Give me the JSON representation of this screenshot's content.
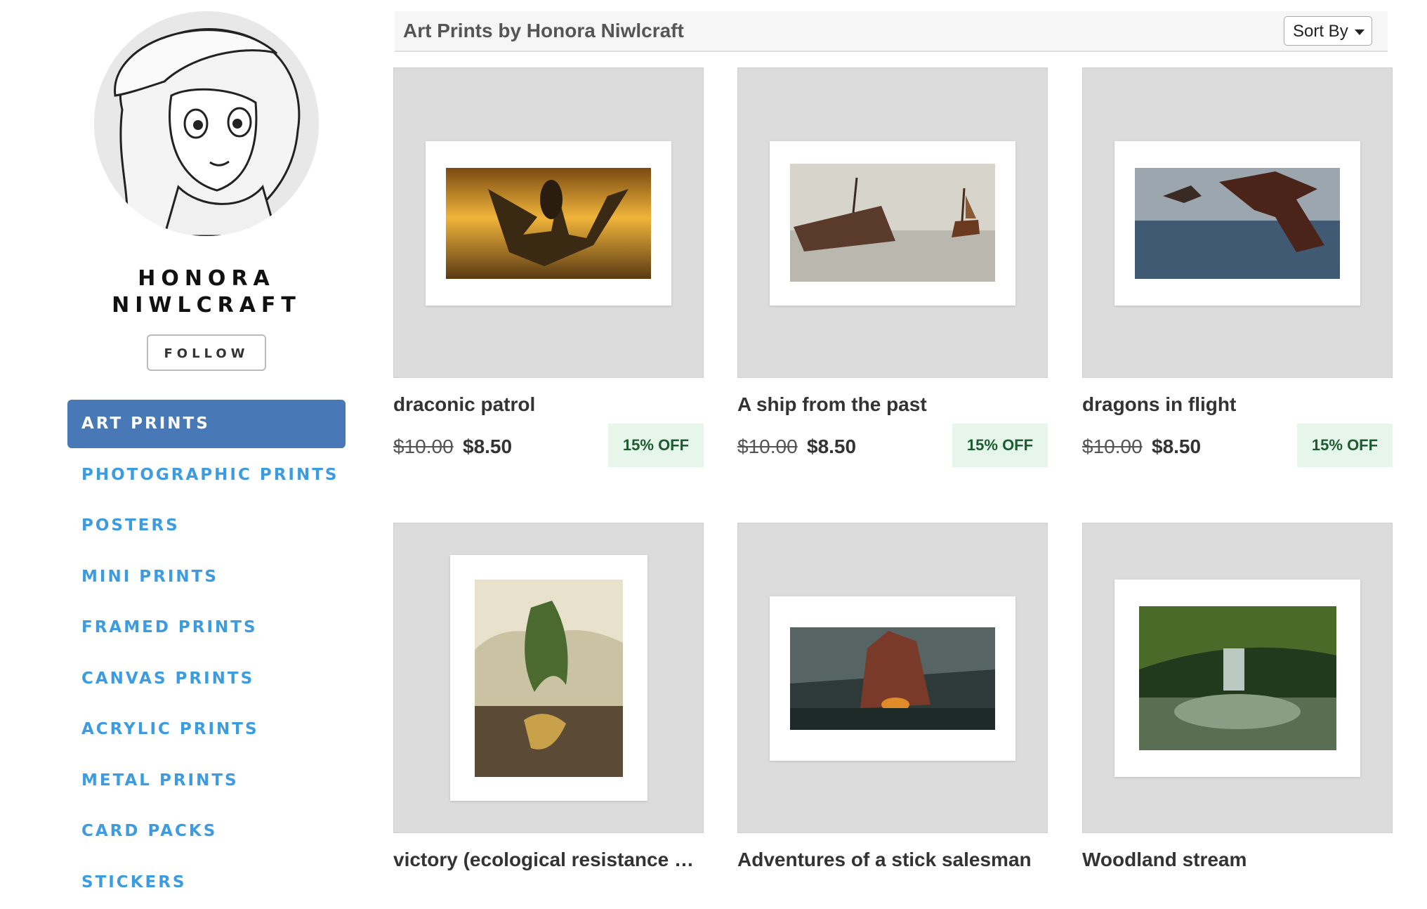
{
  "sidebar": {
    "artist_name": "HONORA NIWLCRAFT",
    "follow_label": "FOLLOW",
    "nav_items": [
      {
        "label": "ART PRINTS",
        "active": true
      },
      {
        "label": "PHOTOGRAPHIC PRINTS",
        "active": false
      },
      {
        "label": "POSTERS",
        "active": false
      },
      {
        "label": "MINI PRINTS",
        "active": false
      },
      {
        "label": "FRAMED PRINTS",
        "active": false
      },
      {
        "label": "CANVAS PRINTS",
        "active": false
      },
      {
        "label": "ACRYLIC PRINTS",
        "active": false
      },
      {
        "label": "METAL PRINTS",
        "active": false
      },
      {
        "label": "CARD PACKS",
        "active": false
      },
      {
        "label": "STICKERS",
        "active": false
      }
    ]
  },
  "header": {
    "title": "Art Prints by Honora Niwlcraft",
    "sort_label": "Sort By"
  },
  "products": [
    {
      "title": "draconic patrol",
      "old_price": "$10.00",
      "new_price": "$8.50",
      "discount": "15% OFF"
    },
    {
      "title": "A ship from the past",
      "old_price": "$10.00",
      "new_price": "$8.50",
      "discount": "15% OFF"
    },
    {
      "title": "dragons in flight",
      "old_price": "$10.00",
      "new_price": "$8.50",
      "discount": "15% OFF"
    },
    {
      "title": "victory (ecological resistance …",
      "old_price": "",
      "new_price": "",
      "discount": ""
    },
    {
      "title": "Adventures of a stick salesman",
      "old_price": "",
      "new_price": "",
      "discount": ""
    },
    {
      "title": "Woodland stream",
      "old_price": "",
      "new_price": "",
      "discount": ""
    }
  ],
  "colors": {
    "accent": "#4879b6",
    "nav_text": "#3d9be0",
    "badge_bg": "#e6f6ea",
    "badge_text": "#1d5b30"
  }
}
